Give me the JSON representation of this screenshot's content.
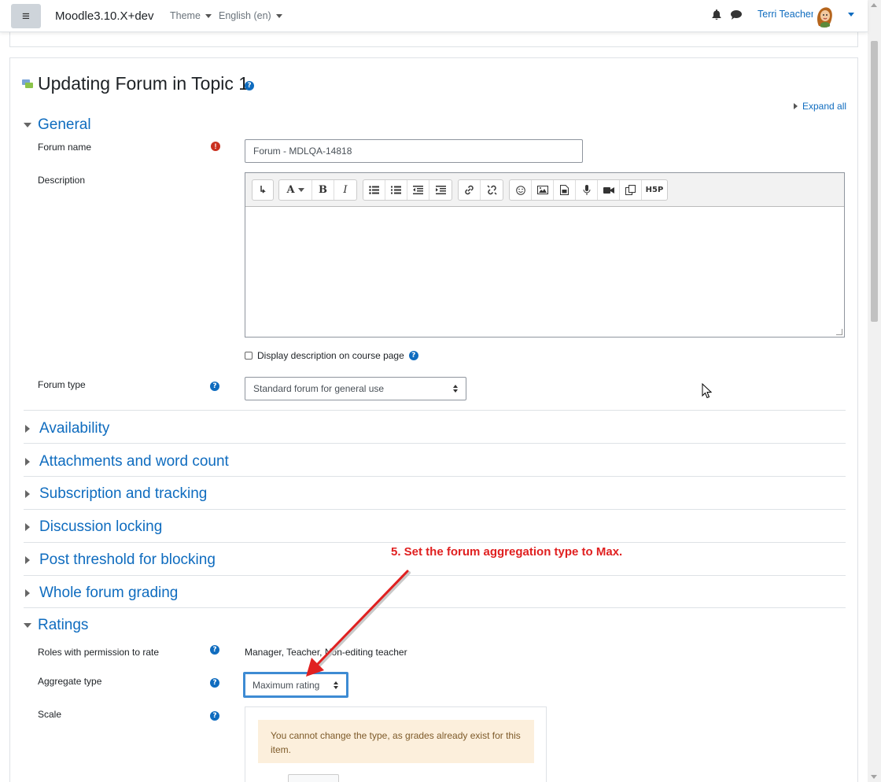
{
  "navbar": {
    "brand": "Moodle3.10.X+dev",
    "theme_label": "Theme",
    "language_label": "English (en)",
    "user_name": "Terri Teacher"
  },
  "page": {
    "title": "Updating Forum in Topic 1",
    "expand_all": "Expand all"
  },
  "general": {
    "header": "General",
    "forum_name_label": "Forum name",
    "forum_name_value": "Forum - MDLQA-14818",
    "description_label": "Description",
    "display_description_label": "Display description on course page",
    "forum_type_label": "Forum type",
    "forum_type_value": "Standard forum for general use"
  },
  "editor_toolbar": {
    "font_style": "A",
    "bold": "B",
    "italic": "I",
    "h5p": "H5P"
  },
  "sections": {
    "availability": "Availability",
    "attachments": "Attachments and word count",
    "subscription": "Subscription and tracking",
    "discussion_locking": "Discussion locking",
    "post_threshold": "Post threshold for blocking",
    "whole_forum_grading": "Whole forum grading",
    "ratings": "Ratings"
  },
  "ratings": {
    "roles_label": "Roles with permission to rate",
    "roles_value": "Manager, Teacher, Non-editing teacher",
    "aggregate_label": "Aggregate type",
    "aggregate_value": "Maximum rating",
    "scale_label": "Scale",
    "scale_alert": "You cannot change the type, as grades already exist for this item."
  },
  "annotation": {
    "text": "5. Set the forum aggregation type to Max."
  },
  "colors": {
    "link": "#0f6cbf",
    "required": "#ca3120",
    "annotation": "#e02020",
    "focus_border": "#3d8bd3",
    "alert_bg": "#fcefdc"
  }
}
